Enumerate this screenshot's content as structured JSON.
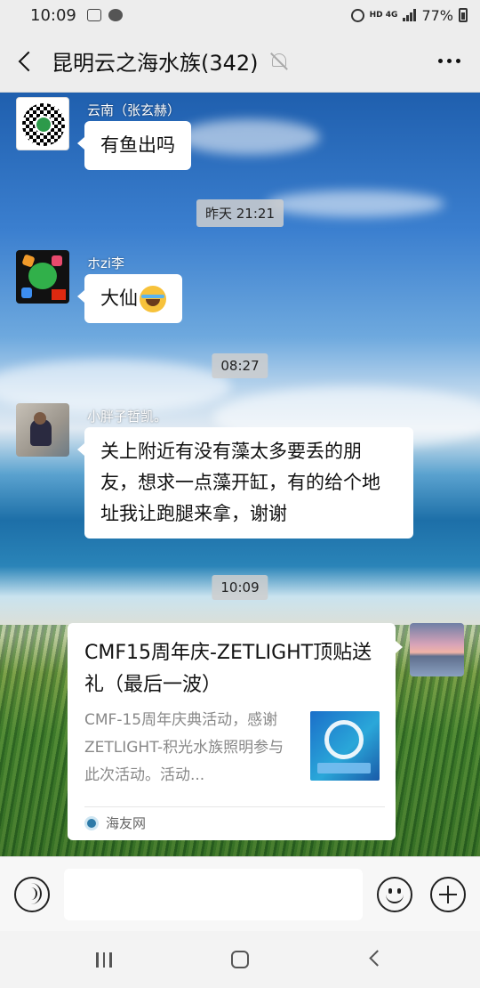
{
  "status_bar": {
    "time": "10:09",
    "network": "HD 4G",
    "battery": "77%"
  },
  "header": {
    "title": "昆明云之海水族(342)"
  },
  "messages": [
    {
      "sender": "云南（张玄赫）",
      "text": "有鱼出吗"
    },
    {
      "timestamp": "昨天 21:21"
    },
    {
      "sender": "ホzi李",
      "text": "大仙"
    },
    {
      "timestamp": "08:27"
    },
    {
      "sender": "小胖子哲凯。",
      "text": "关上附近有没有藻太多要丢的朋友，想求一点藻开缸，有的给个地址我让跑腿来拿，谢谢"
    },
    {
      "timestamp": "10:09"
    }
  ],
  "link_card": {
    "title": "CMF15周年庆-ZETLIGHT顶贴送礼（最后一波）",
    "description": "CMF-15周年庆典活动，感谢ZETLIGHT-积光水族照明参与此次活动。活动...",
    "source": "海友网"
  },
  "icons": {
    "back": "chevron-left-icon",
    "mute": "bell-off-icon",
    "more": "more-icon",
    "voice": "voice-icon",
    "emoji": "emoji-icon",
    "plus": "plus-icon"
  }
}
